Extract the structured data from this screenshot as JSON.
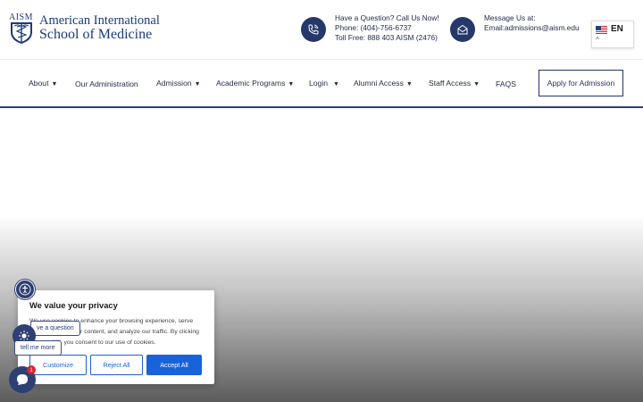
{
  "logo": {
    "mark": "AISM",
    "line1": "American International",
    "line2": "School of Medicine"
  },
  "contact_phone": {
    "icon": "phone-icon",
    "heading": "Have a Question? Call Us Now!",
    "phone": "Phone: (404)-756-6737",
    "tollfree": "Toll Free: 888 403 AISM (2476)"
  },
  "contact_email": {
    "icon": "envelope-icon",
    "heading": "Message Us at:",
    "email": "Email:admissions@aism.edu"
  },
  "language": {
    "code": "EN",
    "caret": "^",
    "flag": "us-flag-icon"
  },
  "nav": {
    "about": "About",
    "administration": "Our Administration",
    "admission": "Admission",
    "academic": "Academic Programs",
    "login": "Login",
    "alumni": "Alumni Access",
    "staff": "Staff Access",
    "faqs": "FAQS",
    "apply": "Apply for Admission",
    "arrow": "▼"
  },
  "cookie": {
    "title": "We value your privacy",
    "body": "We use cookies to enhance your browsing experience, serve personalized ads or content, and analyze our traffic. By clicking \"Accept All\", you consent to our use of cookies.",
    "customize": "Customize",
    "reject": "Reject All",
    "accept": "Accept All"
  },
  "widgets": {
    "bubble1": "ve a question",
    "bubble2": "tell me more",
    "chat_badge": "1"
  },
  "colors": {
    "brand_navy": "#26386a",
    "cookie_blue": "#1863dc",
    "badge_red": "#d6252f"
  }
}
